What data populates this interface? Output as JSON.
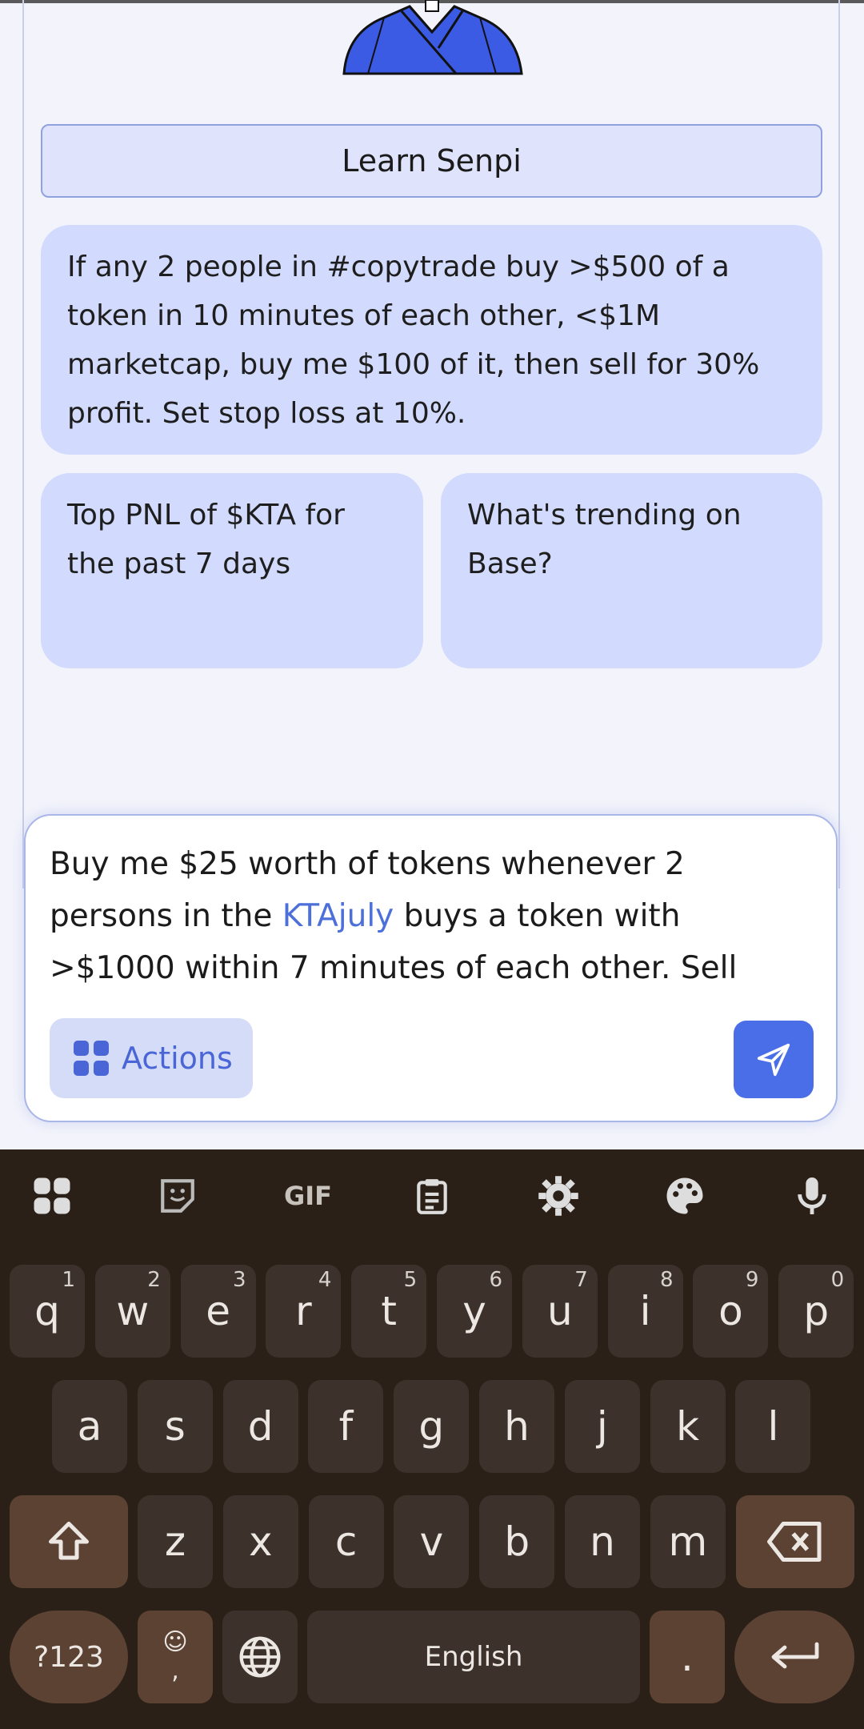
{
  "learn_button": "Learn Senpi",
  "suggestions": {
    "big": "If any 2 people in #copytrade buy >$500 of a token in 10 minutes of each other, <$1M marketcap, buy me $100 of it, then sell for 30% profit. Set stop loss at 10%.",
    "left": "Top PNL of $KTA for the past 7 days",
    "right": "What's trending on Base?"
  },
  "composer": {
    "text_before": "Buy me $25 worth of tokens whenever 2 persons in the ",
    "mention": "KTAjuly",
    "text_after": " buys a token with >$1000 within 7 minutes of each other. Sell",
    "actions_label": "Actions"
  },
  "keyboard": {
    "toolbar": [
      "apps-grid-icon",
      "sticker-icon",
      "gif-icon",
      "clipboard-icon",
      "settings-gear-icon",
      "palette-icon",
      "microphone-icon"
    ],
    "gif_label": "GIF",
    "row1": [
      {
        "k": "q",
        "n": "1"
      },
      {
        "k": "w",
        "n": "2"
      },
      {
        "k": "e",
        "n": "3"
      },
      {
        "k": "r",
        "n": "4"
      },
      {
        "k": "t",
        "n": "5"
      },
      {
        "k": "y",
        "n": "6"
      },
      {
        "k": "u",
        "n": "7"
      },
      {
        "k": "i",
        "n": "8"
      },
      {
        "k": "o",
        "n": "9"
      },
      {
        "k": "p",
        "n": "0"
      }
    ],
    "row2": [
      "a",
      "s",
      "d",
      "f",
      "g",
      "h",
      "j",
      "k",
      "l"
    ],
    "row3": [
      "z",
      "x",
      "c",
      "v",
      "b",
      "n",
      "m"
    ],
    "numbers_key": "?123",
    "emoji_key_top": "☺",
    "emoji_key_bottom": ",",
    "space_label": "English",
    "period_key": "."
  },
  "colors": {
    "accent": "#4a6ee8",
    "card_bg": "#d2dbfd",
    "keyboard_bg": "#2b2018"
  }
}
